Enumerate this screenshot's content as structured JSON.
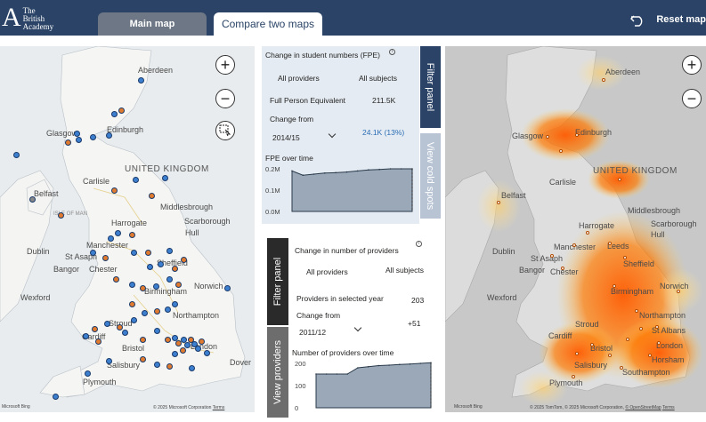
{
  "header": {
    "logo_mark": "A",
    "logo_text": "The\nBritish\nAcademy",
    "tabs": [
      {
        "label": "Main map",
        "active": false
      },
      {
        "label": "Compare two maps",
        "active": true
      }
    ],
    "reset_label": "Reset map"
  },
  "left_map": {
    "places": {
      "aberdeen": "Aberdeen",
      "glasgow": "Glasgow",
      "edinburgh": "Edinburgh",
      "uk": "UNITED\nKINGDOM",
      "carlisle": "Carlisle",
      "middlesbrough": "Middlesbrough",
      "belfast": "Belfast",
      "isle_of_man": "ISLE OF MAN",
      "harrogate": "Harrogate",
      "scarborough": "Scarborough",
      "hull": "Hull",
      "dublin": "Dublin",
      "manchester": "Manchester",
      "st_asaph": "St Asaph",
      "bangor": "Bangor",
      "chester": "Chester",
      "sheffield": "Sheffield",
      "wexford": "Wexford",
      "birmingham": "Birmingham",
      "norwich": "Norwich",
      "northampton": "Northampton",
      "stroud": "Stroud",
      "cardiff": "Cardiff",
      "bristol": "Bristol",
      "london": "London",
      "salisbury": "Salisbury",
      "dover": "Dover",
      "plymouth": "Plymouth"
    },
    "attribution": "© 2025 Microsoft Corporation",
    "terms": "Terms",
    "bing": "Microsoft Bing"
  },
  "right_map": {
    "places": {
      "aberdeen": "Aberdeen",
      "glasgow": "Glasgow",
      "edinburgh": "Edinburgh",
      "uk": "UNITED\nKINGDOM",
      "carlisle": "Carlisle",
      "middlesbrough": "Middlesbrough",
      "belfast": "Belfast",
      "harrogate": "Harrogate",
      "scarborough": "Scarborough",
      "hull": "Hull",
      "leeds": "Leeds",
      "dublin": "Dublin",
      "manchester": "Manchester",
      "st_asaph": "St Asaph",
      "bangor": "Bangor",
      "chester": "Chester",
      "sheffield": "Sheffield",
      "wexford": "Wexford",
      "birmingham": "Birmingham",
      "norwich": "Norwich",
      "northampton": "Northampton",
      "stroud": "Stroud",
      "cardiff": "Cardiff",
      "st_albans": "St Albans",
      "bristol": "Bristol",
      "london": "London",
      "horsham": "Horsham",
      "salisbury": "Salisbury",
      "southampton": "Southampton",
      "plymouth": "Plymouth"
    },
    "attribution": "© 2025 TomTom, © 2025 Microsoft Corporation,",
    "osm": "© OpenStreetMap",
    "terms": "Terms",
    "bing": "Microsoft Bing"
  },
  "students": {
    "title": "Change in student numbers (FPE)",
    "providers_filter": "All providers",
    "subjects_filter": "All subjects",
    "metric_label": "Full Person Equivalent",
    "metric_value": "211.5K",
    "change_from_label": "Change from",
    "change_from_year": "2014/15",
    "change_value": "24.1K (13%)",
    "chart_title": "FPE over time",
    "side_tab_filter": "Filter panel",
    "side_tab_cold": "View cold spots"
  },
  "providers": {
    "title": "Change in number of providers",
    "providers_filter": "All providers",
    "subjects_filter": "All subjects",
    "selected_label": "Providers in selected year",
    "selected_value": "203",
    "change_from_label": "Change from",
    "change_from_year": "2011/12",
    "change_value": "+51",
    "chart_title": "Number of providers over time",
    "side_tab_filter": "Filter panel",
    "side_tab_view": "View providers"
  },
  "colors": {
    "header": "#2a4366",
    "tab_inactive": "#6d7785",
    "side_tab": "#2a4366",
    "side_tab_light": "#b8c4d4",
    "dot_blue": "#3d7fcf",
    "dot_orange": "#e07a2e",
    "heat": "#ff6a00",
    "chart_fill": "#9aa8b8"
  },
  "chart_data": [
    {
      "type": "area",
      "title": "FPE over time",
      "y_ticks": [
        "0.0M",
        "0.1M",
        "0.2M"
      ],
      "ylim": [
        0,
        0.2
      ],
      "values": [
        0.19,
        0.17,
        0.175,
        0.18,
        0.182,
        0.185,
        0.19,
        0.195,
        0.197,
        0.2,
        0.2,
        0.2
      ]
    },
    {
      "type": "area",
      "title": "Number of providers over time",
      "y_ticks": [
        "0",
        "100",
        "200"
      ],
      "ylim": [
        0,
        200
      ],
      "values": [
        152,
        152,
        152,
        152,
        180,
        185,
        190,
        192,
        195,
        197,
        200,
        203
      ]
    }
  ]
}
